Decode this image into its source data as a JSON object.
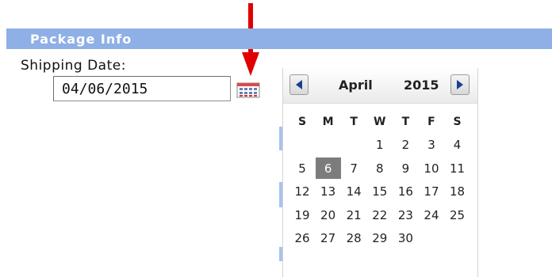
{
  "section": {
    "title": "Package Info"
  },
  "shipping": {
    "label": "Shipping Date:",
    "value": "04/06/2015"
  },
  "calendar": {
    "month": "April",
    "year": "2015",
    "weekdays": [
      "S",
      "M",
      "T",
      "W",
      "T",
      "F",
      "S"
    ],
    "selected_day": "6",
    "weeks": [
      [
        "",
        "",
        "",
        "1",
        "2",
        "3",
        "4"
      ],
      [
        "5",
        "6",
        "7",
        "8",
        "9",
        "10",
        "11"
      ],
      [
        "12",
        "13",
        "14",
        "15",
        "16",
        "17",
        "18"
      ],
      [
        "19",
        "20",
        "21",
        "22",
        "23",
        "24",
        "25"
      ],
      [
        "26",
        "27",
        "28",
        "29",
        "30",
        "",
        ""
      ]
    ]
  },
  "colors": {
    "header_bar": "#8fb0e6",
    "arrow": "#e00000",
    "selected_day_bg": "#7c7c7c"
  }
}
